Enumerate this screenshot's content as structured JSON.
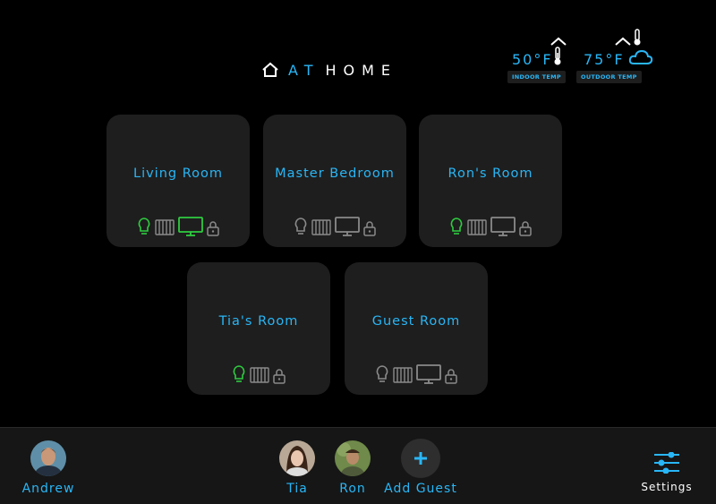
{
  "header": {
    "title_at": "AT",
    "title_home": "HOME"
  },
  "climate": {
    "indoor": {
      "value": "50°F",
      "label": "INDOOR TEMP"
    },
    "outdoor": {
      "value": "75°F",
      "label": "OUTDOOR TEMP"
    }
  },
  "rooms": [
    {
      "name": "Living Room"
    },
    {
      "name": "Master Bedroom"
    },
    {
      "name": "Ron's Room"
    },
    {
      "name": "Tia's Room"
    },
    {
      "name": "Guest Room"
    }
  ],
  "people": {
    "andrew": "Andrew",
    "tia": "Tia",
    "ron": "Ron",
    "add_guest": "Add Guest"
  },
  "settings": {
    "label": "Settings"
  },
  "colors": {
    "accent": "#29b6f6",
    "active": "#2ecc40",
    "inactive": "#8a8a8a",
    "card": "#1e1e1e"
  }
}
